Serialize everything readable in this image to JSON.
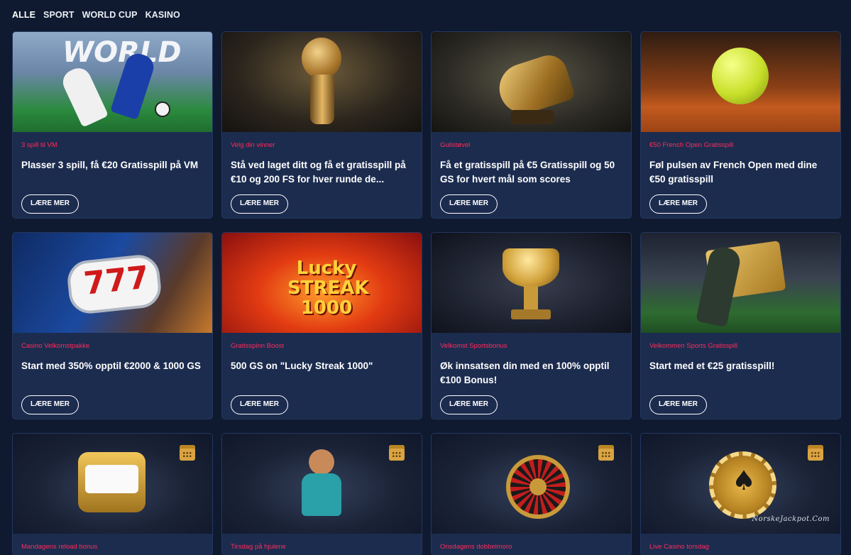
{
  "tabs": [
    "ALLE",
    "SPORT",
    "WORLD CUP",
    "KASINO"
  ],
  "button_label": "LÆRE MER",
  "cards": [
    {
      "tag": "3 spill til VM",
      "title": "Plasser 3 spill, få €20 Gratisspill på VM",
      "image": "world-cup-players",
      "image_text": "WORLD"
    },
    {
      "tag": "Velg din vinner",
      "title": "Stå ved laget ditt og få et gratisspill på €10 og 200 FS for hver runde de...",
      "image": "world-cup-trophy"
    },
    {
      "tag": "Gullstøvel",
      "title": "Få et gratisspill på €5 Gratisspill og 50 GS for hvert mål som scores",
      "image": "golden-boot"
    },
    {
      "tag": "€50 French Open Gratisspill",
      "title": "Føl pulsen av French Open med dine €50 gratisspill",
      "image": "tennis-ball"
    },
    {
      "tag": "Casino Velkomstpakke",
      "title": "Start med 350% opptil €2000 & 1000 GS",
      "image": "slot-777",
      "image_text": "777"
    },
    {
      "tag": "Gratisspinn Boost",
      "title": "500 GS on \"Lucky Streak 1000\"",
      "image": "lucky-streak",
      "image_text": "Lucky STREAK 1000"
    },
    {
      "tag": "Velkomst Sportsbonus",
      "title": "Øk innsatsen din med en 100% opptil €100 Bonus!",
      "image": "sports-trophy"
    },
    {
      "tag": "Velkommen Sports Gratisspill",
      "title": "Start med et €25 gratisspill!",
      "image": "soccer-player"
    },
    {
      "tag": "Mandagens reload bonus",
      "title": "",
      "image": "golden-slot-machine"
    },
    {
      "tag": "Tirsdag på hjulene",
      "title": "",
      "image": "cowboy-character"
    },
    {
      "tag": "Onsdagens dobbelmoro",
      "title": "",
      "image": "roulette-wheel"
    },
    {
      "tag": "Live Casino torsdag",
      "title": "",
      "image": "casino-chip"
    }
  ],
  "watermark": "NorskeJackpot.Com",
  "colors": {
    "background": "#0f1a30",
    "card": "#1c2c4f",
    "tag": "#ff2b5a"
  }
}
